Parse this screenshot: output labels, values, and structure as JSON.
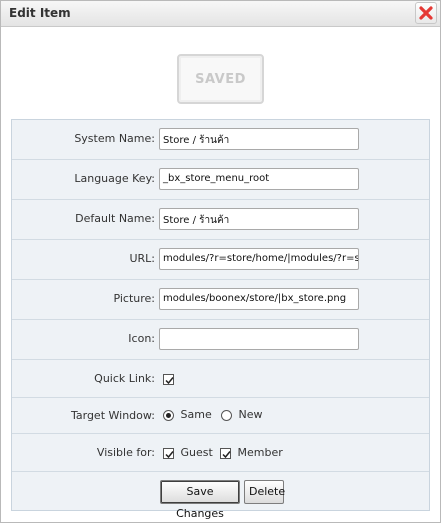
{
  "dialog": {
    "title": "Edit Item",
    "close_label": "close"
  },
  "status": {
    "text": "SAVED"
  },
  "form": {
    "system_name": {
      "label": "System Name:",
      "value": "Store / ร้านค้า"
    },
    "language_key": {
      "label": "Language Key:",
      "value": "_bx_store_menu_root"
    },
    "default_name": {
      "label": "Default Name:",
      "value": "Store / ร้านค้า"
    },
    "url": {
      "label": "URL:",
      "value": "modules/?r=store/home/|modules/?r=store"
    },
    "picture": {
      "label": "Picture:",
      "value": "modules/boonex/store/|bx_store.png"
    },
    "icon": {
      "label": "Icon:",
      "value": ""
    },
    "quick_link": {
      "label": "Quick Link:",
      "checked": true
    },
    "target_window": {
      "label": "Target Window:",
      "options": [
        "Same",
        "New"
      ],
      "selected": "Same"
    },
    "visible_for": {
      "label": "Visible for:",
      "options": [
        {
          "label": "Guest",
          "checked": true
        },
        {
          "label": "Member",
          "checked": true
        }
      ]
    }
  },
  "buttons": {
    "save_label": "Save Changes",
    "delete_label": "Delete"
  },
  "colors": {
    "form_bg": "#eef2f6",
    "close_x": "#e53935"
  }
}
